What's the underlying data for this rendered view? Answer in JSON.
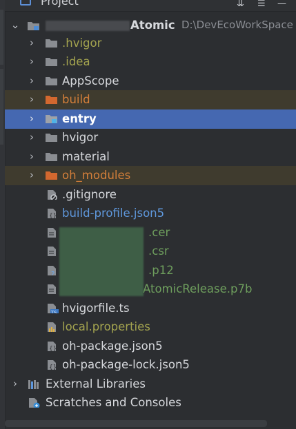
{
  "panel": {
    "title": "Project"
  },
  "colors": {
    "selection": "#4568b1",
    "folder_gray": "#8a8d92",
    "folder_orange": "#d3682f",
    "text_default": "#d6d8dc",
    "text_ignored": "#a3a34f",
    "text_orange": "#d47f3a",
    "text_blue": "#5f98dd",
    "text_green": "#6e9e5d"
  },
  "tree": {
    "root": {
      "name": "Atomic",
      "path": "D:\\DevEcoWorkSpace"
    },
    "items": [
      {
        "label": ".hvigor",
        "icon": "folder-icon"
      },
      {
        "label": ".idea",
        "icon": "folder-icon"
      },
      {
        "label": "AppScope",
        "icon": "folder-icon"
      },
      {
        "label": "build",
        "icon": "folder-excluded-icon"
      },
      {
        "label": "entry",
        "icon": "module-folder-icon"
      },
      {
        "label": "hvigor",
        "icon": "folder-icon"
      },
      {
        "label": "material",
        "icon": "folder-icon"
      },
      {
        "label": "oh_modules",
        "icon": "folder-excluded-icon"
      },
      {
        "label": ".gitignore",
        "icon": "gitignore-file-icon"
      },
      {
        "label": "build-profile.json5",
        "icon": "json-file-icon"
      },
      {
        "label": ".cer",
        "icon": "text-file-icon"
      },
      {
        "label": ".csr",
        "icon": "text-file-icon"
      },
      {
        "label": ".p12",
        "icon": "unknown-file-icon"
      },
      {
        "label": "AtomicRelease.p7b",
        "icon": "text-file-icon"
      },
      {
        "label": "hvigorfile.ts",
        "icon": "typescript-file-icon"
      },
      {
        "label": "local.properties",
        "icon": "properties-file-icon"
      },
      {
        "label": "oh-package.json5",
        "icon": "json-file-icon"
      },
      {
        "label": "oh-package-lock.json5",
        "icon": "json-file-icon"
      }
    ],
    "external_libraries": "External Libraries",
    "scratches": "Scratches and Consoles"
  }
}
